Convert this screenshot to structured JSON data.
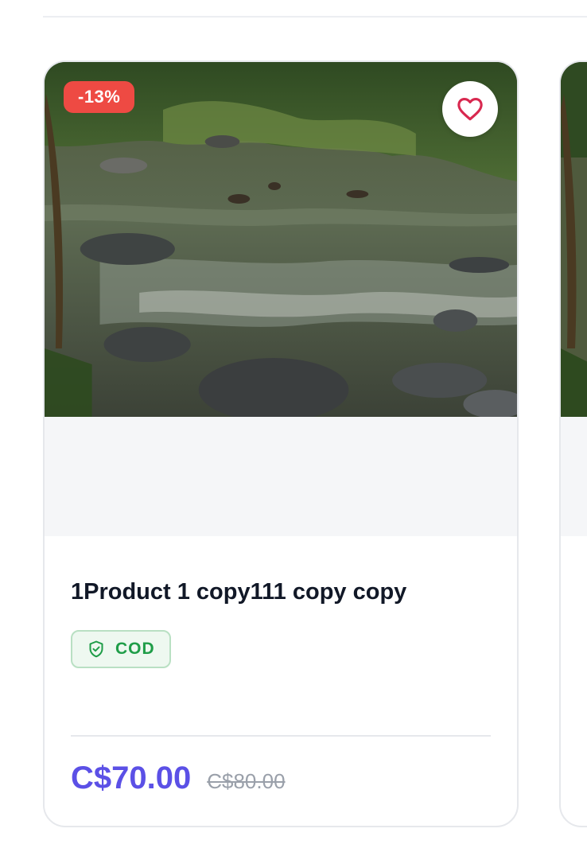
{
  "product": {
    "discount": "-13%",
    "title": "1Product 1 copy111 copy copy",
    "cod_label": "COD",
    "price": "C$70.00",
    "old_price": "C$80.00"
  },
  "icons": {
    "wishlist": "heart-icon",
    "cod": "shield-check-icon"
  },
  "colors": {
    "discount_badge": "#ee4a43",
    "price": "#5b50e6",
    "cod_text": "#1f9d48",
    "heart": "#d8284f"
  }
}
